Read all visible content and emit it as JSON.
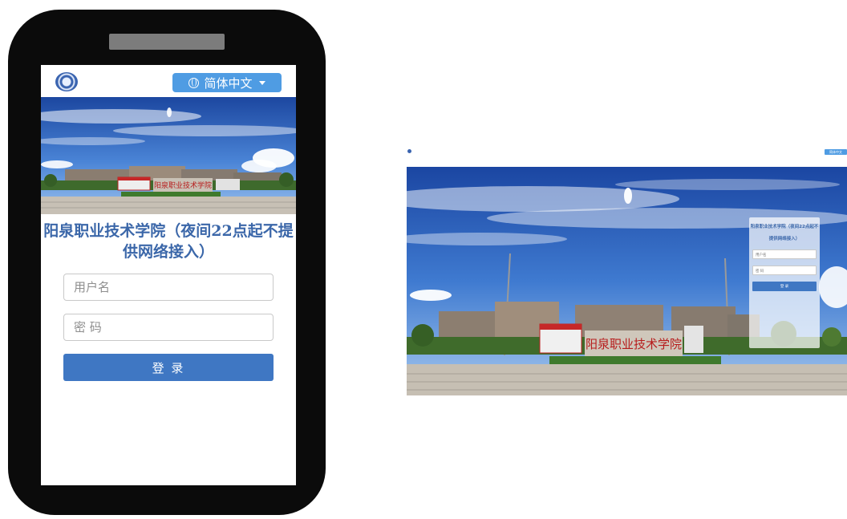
{
  "mobile": {
    "language_button": "简体中文",
    "title": "阳泉职业技术学院（夜间22点起不提供网络接入）",
    "username_placeholder": "用户名",
    "password_placeholder": "密 码",
    "login_button": "登 录",
    "gate_sign": "阳泉职业技术学院"
  },
  "desktop": {
    "language_button": "简体中文",
    "title": "阳泉职业技术学院（夜间22点起不提供网络接入）",
    "username_placeholder": "用户名",
    "password_placeholder": "密 码",
    "login_button": "登 录",
    "gate_sign": "阳泉职业技术学院"
  },
  "colors": {
    "brand_blue": "#3f77c3",
    "title_blue": "#3b67a9",
    "lang_blue": "#4f9ce3",
    "sky": "#1f4fa8"
  },
  "icons": [
    "school-logo-icon",
    "globe-icon",
    "chevron-down-icon"
  ]
}
